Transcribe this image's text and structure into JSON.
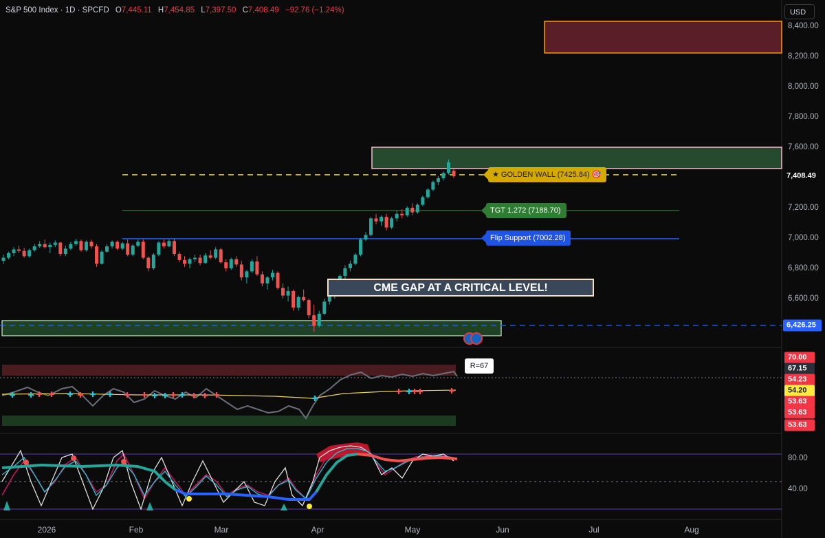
{
  "header": {
    "symbol": "S&P 500 Index · 1D · SPCFD",
    "open_label": "O",
    "open": "7,445.11",
    "high_label": "H",
    "high": "7,454.85",
    "low_label": "L",
    "low": "7,397.50",
    "close_label": "C",
    "close": "7,408.49",
    "change": "−92.76 (−1.24%)"
  },
  "currency_button": "USD",
  "price_axis": {
    "ticks": [
      "8,400.00",
      "8,200.00",
      "8,000.00",
      "7,800.00",
      "7,600.00",
      "7,200.00",
      "7,000.00",
      "6,800.00",
      "6,600.00"
    ],
    "tick_values": [
      8400,
      8200,
      8000,
      7800,
      7600,
      7200,
      7000,
      6800,
      6600
    ],
    "last_price": "7,408.49",
    "dashed_level": "6,426.25"
  },
  "rsi_axis": {
    "tags": [
      {
        "text": "70.00",
        "bg": "#f23645",
        "fg": "#ffffff"
      },
      {
        "text": "67.15",
        "bg": "#2a2e39",
        "fg": "#ffffff"
      },
      {
        "text": "54.23",
        "bg": "#f23645",
        "fg": "#ffffff"
      },
      {
        "text": "54.20",
        "bg": "#ffeb3b",
        "fg": "#131722"
      },
      {
        "text": "53.63",
        "bg": "#f23645",
        "fg": "#ffffff"
      },
      {
        "text": "53.63",
        "bg": "#f23645",
        "fg": "#ffffff"
      },
      {
        "text": "53.63",
        "bg": "#f23645",
        "fg": "#ffffff"
      }
    ],
    "tag_value": "R=67"
  },
  "osc_axis": {
    "ticks": [
      "80.00",
      "40.00"
    ]
  },
  "time_axis": [
    "2026",
    "Feb",
    "Mar",
    "Apr",
    "May",
    "Jun",
    "Jul",
    "Aug"
  ],
  "annotations": {
    "golden_wall": "★ GOLDEN WALL (7425.84) 🎯",
    "target": "TGT 1.272 (7188.70)",
    "flip_support": "Flip Support (7002.28)",
    "cme_gap": "CME GAP AT A CRITICAL LEVEL!"
  },
  "chart_data": {
    "type": "candlestick",
    "y_range": [
      6350,
      8450
    ],
    "levels": {
      "golden_wall": 7425.84,
      "target": 7188.7,
      "flip_support": 7002.28,
      "gap_dashed": 6426.25
    },
    "candles": [
      [
        6850,
        6890,
        6830,
        6870
      ],
      [
        6870,
        6910,
        6860,
        6900
      ],
      [
        6900,
        6940,
        6880,
        6925
      ],
      [
        6925,
        6950,
        6900,
        6915
      ],
      [
        6915,
        6935,
        6870,
        6880
      ],
      [
        6880,
        6930,
        6870,
        6920
      ],
      [
        6920,
        6960,
        6910,
        6945
      ],
      [
        6945,
        6980,
        6935,
        6960
      ],
      [
        6960,
        6990,
        6930,
        6940
      ],
      [
        6940,
        6970,
        6900,
        6955
      ],
      [
        6955,
        6985,
        6940,
        6970
      ],
      [
        6970,
        6975,
        6880,
        6895
      ],
      [
        6895,
        6950,
        6880,
        6930
      ],
      [
        6930,
        6975,
        6920,
        6960
      ],
      [
        6960,
        6995,
        6950,
        6980
      ],
      [
        6980,
        6990,
        6910,
        6920
      ],
      [
        6920,
        6985,
        6910,
        6975
      ],
      [
        6975,
        6990,
        6930,
        6945
      ],
      [
        6945,
        6960,
        6810,
        6830
      ],
      [
        6830,
        6920,
        6825,
        6910
      ],
      [
        6910,
        6960,
        6900,
        6945
      ],
      [
        6945,
        6985,
        6930,
        6975
      ],
      [
        6975,
        6985,
        6920,
        6930
      ],
      [
        6930,
        6975,
        6920,
        6965
      ],
      [
        6965,
        6990,
        6880,
        6890
      ],
      [
        6890,
        6960,
        6880,
        6950
      ],
      [
        6950,
        6990,
        6940,
        6975
      ],
      [
        6975,
        6990,
        6860,
        6870
      ],
      [
        6870,
        6880,
        6780,
        6800
      ],
      [
        6800,
        6900,
        6790,
        6890
      ],
      [
        6890,
        6980,
        6880,
        6970
      ],
      [
        6970,
        6990,
        6930,
        6945
      ],
      [
        6945,
        6990,
        6940,
        6980
      ],
      [
        6980,
        6995,
        6880,
        6895
      ],
      [
        6895,
        6910,
        6840,
        6855
      ],
      [
        6855,
        6880,
        6810,
        6830
      ],
      [
        6830,
        6870,
        6800,
        6860
      ],
      [
        6860,
        6890,
        6840,
        6870
      ],
      [
        6870,
        6890,
        6820,
        6835
      ],
      [
        6835,
        6900,
        6830,
        6885
      ],
      [
        6885,
        6920,
        6860,
        6870
      ],
      [
        6870,
        6940,
        6860,
        6925
      ],
      [
        6925,
        6935,
        6830,
        6840
      ],
      [
        6840,
        6860,
        6780,
        6800
      ],
      [
        6800,
        6870,
        6790,
        6860
      ],
      [
        6860,
        6880,
        6810,
        6825
      ],
      [
        6825,
        6850,
        6720,
        6740
      ],
      [
        6740,
        6790,
        6700,
        6780
      ],
      [
        6780,
        6860,
        6770,
        6845
      ],
      [
        6845,
        6880,
        6750,
        6760
      ],
      [
        6760,
        6780,
        6680,
        6700
      ],
      [
        6700,
        6750,
        6660,
        6740
      ],
      [
        6740,
        6790,
        6720,
        6770
      ],
      [
        6770,
        6780,
        6660,
        6670
      ],
      [
        6670,
        6700,
        6600,
        6620
      ],
      [
        6620,
        6680,
        6580,
        6650
      ],
      [
        6650,
        6660,
        6520,
        6540
      ],
      [
        6540,
        6620,
        6520,
        6610
      ],
      [
        6610,
        6660,
        6580,
        6590
      ],
      [
        6590,
        6600,
        6470,
        6490
      ],
      [
        6490,
        6560,
        6380,
        6420
      ],
      [
        6420,
        6520,
        6410,
        6500
      ],
      [
        6500,
        6600,
        6490,
        6580
      ],
      [
        6580,
        6640,
        6560,
        6620
      ],
      [
        6620,
        6680,
        6600,
        6660
      ],
      [
        6660,
        6760,
        6650,
        6750
      ],
      [
        6750,
        6820,
        6730,
        6800
      ],
      [
        6800,
        6850,
        6780,
        6830
      ],
      [
        6830,
        6900,
        6820,
        6890
      ],
      [
        6890,
        7000,
        6880,
        6990
      ],
      [
        6990,
        7040,
        6980,
        7020
      ],
      [
        7020,
        7140,
        7010,
        7130
      ],
      [
        7130,
        7160,
        7090,
        7110
      ],
      [
        7110,
        7150,
        7080,
        7140
      ],
      [
        7140,
        7160,
        7050,
        7070
      ],
      [
        7070,
        7140,
        7060,
        7130
      ],
      [
        7130,
        7180,
        7110,
        7160
      ],
      [
        7160,
        7190,
        7130,
        7150
      ],
      [
        7150,
        7210,
        7140,
        7200
      ],
      [
        7200,
        7230,
        7150,
        7170
      ],
      [
        7170,
        7230,
        7160,
        7220
      ],
      [
        7220,
        7280,
        7210,
        7270
      ],
      [
        7270,
        7330,
        7260,
        7320
      ],
      [
        7320,
        7380,
        7310,
        7370
      ],
      [
        7370,
        7410,
        7350,
        7395
      ],
      [
        7395,
        7440,
        7380,
        7430
      ],
      [
        7430,
        7520,
        7420,
        7500
      ],
      [
        7445,
        7455,
        7397,
        7408
      ]
    ]
  }
}
